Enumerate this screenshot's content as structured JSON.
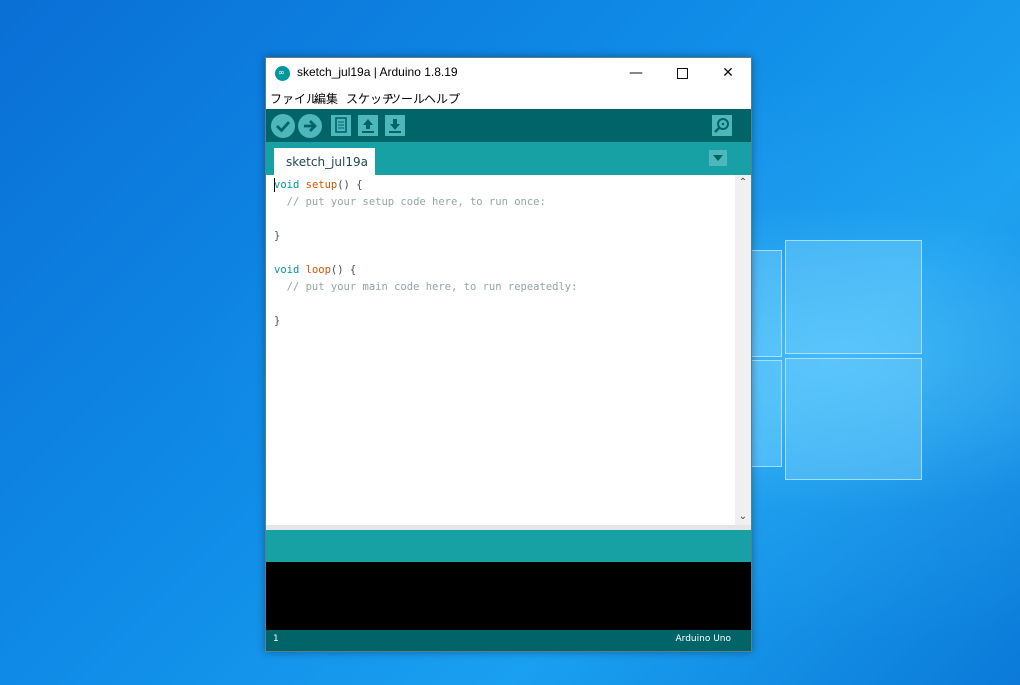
{
  "window": {
    "title": "sketch_jul19a | Arduino 1.8.19",
    "controls": {
      "minimize": "—",
      "close": "✕"
    }
  },
  "menu": [
    "ファイル",
    "編集",
    "スケッチ",
    "ツール",
    "ヘルプ"
  ],
  "toolbar": {
    "buttons": [
      "verify-icon",
      "upload-icon",
      "new-icon",
      "open-icon",
      "save-icon"
    ],
    "serial_monitor": "serial-monitor-icon"
  },
  "tabs": [
    {
      "label": "sketch_jul19a"
    }
  ],
  "editor": {
    "lines": [
      {
        "kw": "void",
        "fn": "setup",
        "rest": "() {"
      },
      {
        "comment": "  // put your setup code here, to run once:"
      },
      {
        "text": ""
      },
      {
        "text": "}"
      },
      {
        "text": ""
      },
      {
        "kw": "void",
        "fn": "loop",
        "rest": "() {"
      },
      {
        "comment": "  // put your main code here, to run repeatedly:"
      },
      {
        "text": ""
      },
      {
        "text": "}"
      }
    ]
  },
  "footer": {
    "line_number": "1",
    "board": "Arduino Uno"
  },
  "colors": {
    "teal_dark": "#006468",
    "teal": "#17a1a5",
    "button": "#4db7bb",
    "keyword": "#00979c",
    "function": "#d35400",
    "comment": "#95a5a6"
  }
}
